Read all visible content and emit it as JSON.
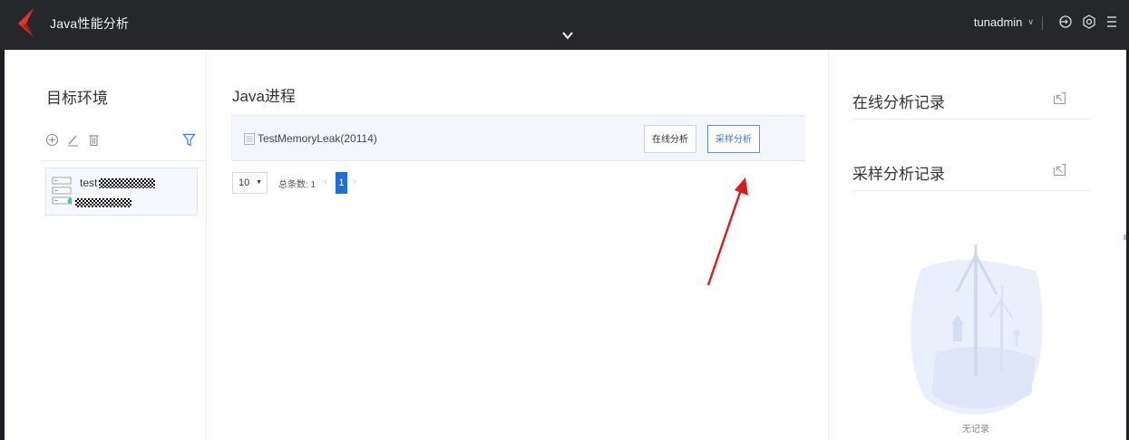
{
  "header": {
    "app_title": "Java性能分析",
    "username": "tunadmin",
    "icons": [
      "logo-icon",
      "chevron-down-icon",
      "user-caret-icon",
      "logout-icon",
      "settings-icon",
      "menu-icon"
    ]
  },
  "left_panel": {
    "title": "目标环境",
    "toolbar_icons": [
      "add-circle-icon",
      "edit-icon",
      "delete-icon",
      "filter-icon"
    ],
    "environments": [
      {
        "name": "test",
        "status_color": "#4cd080"
      }
    ]
  },
  "main_panel": {
    "title": "Java进程",
    "processes": [
      {
        "name": "TestMemoryLeak(20114)",
        "actions": [
          "在线分析",
          "采样分析"
        ]
      }
    ],
    "pagination": {
      "page_size": "10",
      "total_label": "总条数: 1",
      "current_page": "1",
      "prev": "‹",
      "next": "›"
    }
  },
  "right_panel": {
    "online_records_title": "在线分析记录",
    "sample_records_title": "采样分析记录",
    "empty_text": "无记录"
  },
  "colors": {
    "topbar_bg": "#26272b",
    "accent_blue": "#1f6fd9",
    "annotation_red": "#e0191c",
    "status_green": "#4cd080"
  }
}
